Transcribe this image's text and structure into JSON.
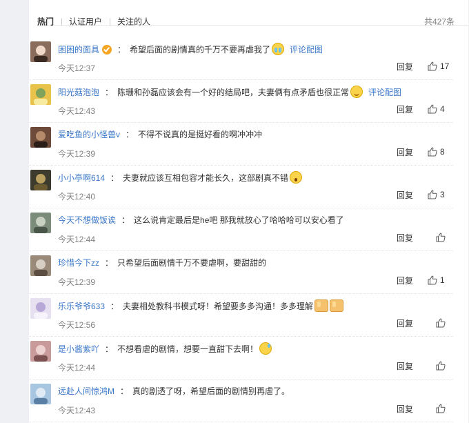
{
  "tabs": {
    "hot": "热门",
    "verified": "认证用户",
    "following": "关注的人",
    "count": "共427条"
  },
  "colors": {
    "link": "#3a77c9",
    "muted": "#808080",
    "badge": "#f5a623"
  },
  "comments": [
    {
      "user": "困困的面具",
      "verified": true,
      "text": "希望后面的剧情真的千万不要再虐我了",
      "emoji": [
        "cry"
      ],
      "pic_link": "评论配图",
      "time": "今天12:37",
      "reply": "回复",
      "likes": "17"
    },
    {
      "user": "阳光菇泡泡",
      "verified": false,
      "text": "陈珊和孙磊应该会有一个好的结局吧，夫妻俩有点矛盾也很正常",
      "emoji": [
        "smile"
      ],
      "pic_link": "评论配图",
      "time": "今天12:43",
      "reply": "回复",
      "likes": "4"
    },
    {
      "user": "爱吃鱼的小怪兽v",
      "verified": false,
      "text": "不得不说真的是挺好看的啊冲冲冲",
      "emoji": [],
      "pic_link": "",
      "time": "今天12:39",
      "reply": "回复",
      "likes": "8"
    },
    {
      "user": "小小亭啊614",
      "verified": false,
      "text": "夫妻就应该互相包容才能长久，这部剧真不错",
      "emoji": [
        "shock"
      ],
      "pic_link": "",
      "time": "今天12:40",
      "reply": "回复",
      "likes": "3"
    },
    {
      "user": "今天不想做饭诶",
      "verified": false,
      "text": "这么说肯定最后是he吧 那我就放心了哈哈哈可以安心看了",
      "emoji": [],
      "pic_link": "",
      "time": "今天12:44",
      "reply": "回复",
      "likes": ""
    },
    {
      "user": "珍惜今下zz",
      "verified": false,
      "text": "只希望后面剧情千万不要虐啊，要甜甜的",
      "emoji": [],
      "pic_link": "",
      "time": "今天12:39",
      "reply": "回复",
      "likes": "1"
    },
    {
      "user": "乐乐爷爷633",
      "verified": false,
      "text": "夫妻相处教科书模式呀！希望要多多沟通！多多理解",
      "emoji": [
        "thumb",
        "thumb"
      ],
      "pic_link": "",
      "time": "今天12:56",
      "reply": "回复",
      "likes": ""
    },
    {
      "user": "是小酱紫吖",
      "verified": false,
      "text": "不想看虐的剧情，想要一直甜下去啊！",
      "emoji": [
        "sweat"
      ],
      "pic_link": "",
      "time": "今天12:44",
      "reply": "回复",
      "likes": ""
    },
    {
      "user": "远赴人间惊鸿M",
      "verified": false,
      "text": "真的剧透了呀，希望后面的剧情别再虐了。",
      "emoji": [],
      "pic_link": "",
      "time": "今天12:43",
      "reply": "回复",
      "likes": ""
    }
  ]
}
